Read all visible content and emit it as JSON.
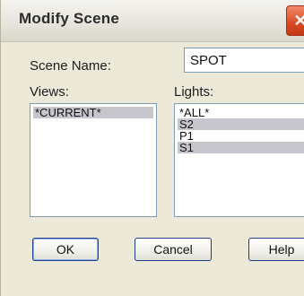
{
  "dialog": {
    "title": "Modify Scene",
    "close_glyph": "✕"
  },
  "scene_name": {
    "label": "Scene Name:",
    "value": "SPOT"
  },
  "views": {
    "label": "Views:",
    "items": [
      "*CURRENT*"
    ]
  },
  "lights": {
    "label": "Lights:",
    "items": [
      "*ALL*",
      "S2",
      "P1",
      "S1"
    ],
    "selected": [
      "S2",
      "S1"
    ]
  },
  "buttons": {
    "ok": "OK",
    "cancel": "Cancel",
    "help": "Help"
  }
}
